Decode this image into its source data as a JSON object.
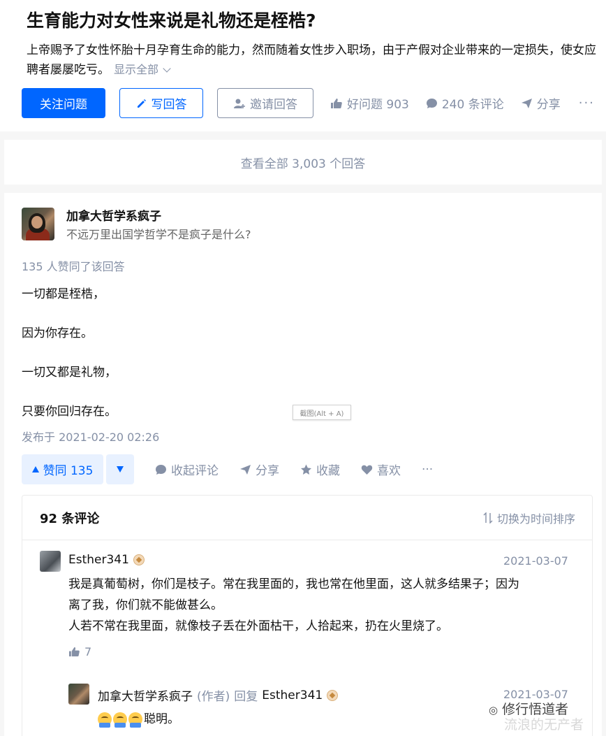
{
  "question": {
    "title": "生育能力对女性来说是礼物还是桎梏?",
    "description": "上帝赐予了女性怀胎十月孕育生命的能力，然而随着女性步入职场，由于产假对企业带来的一定损失，使女应聘者屡屡吃亏。",
    "show_all": "显示全部",
    "follow_label": "关注问题",
    "write_label": "写回答",
    "invite_label": "邀请回答",
    "good_question": "好问题 903",
    "comments": "240 条评论",
    "share": "分享"
  },
  "view_all": "查看全部 3,003 个回答",
  "answer": {
    "author": "加拿大哲学系疯子",
    "bio": "不远万里出国学哲学不是疯子是什么?",
    "voters": "135 人赞同了该回答",
    "paragraphs": [
      "一切都是桎梏，",
      "因为你存在。",
      "一切又都是礼物，",
      "只要你回归存在。"
    ],
    "screenshot_tip": "截图(Alt + A)",
    "published": "发布于 2021-02-20 02:26",
    "vote_up": "赞同 135",
    "collapse_comments": "收起评论",
    "share": "分享",
    "collect": "收藏",
    "like": "喜欢"
  },
  "comments": {
    "count_title": "92 条评论",
    "sort_label": "切换为时间排序",
    "items": [
      {
        "user": "Esther341",
        "date": "2021-03-07",
        "line1": "我是真葡萄树，你们是枝子。常在我里面的，我也常在他里面，这人就多结果子；因为",
        "line2": "离了我，你们就不能做甚么。",
        "line3": "人若不常在我里面，就像枝子丢在外面枯干，人拾起来，扔在火里烧了。",
        "likes": "7"
      },
      {
        "user": "加拿大哲学系疯子",
        "author_tag": "(作者)",
        "reply_word": "回复",
        "reply_to": "Esther341",
        "date": "2021-03-07",
        "text": "聪明。"
      }
    ]
  },
  "watermark": {
    "line1": "修行悟道者",
    "line2": "流浪的无产者"
  },
  "colors": {
    "brand": "#0066ff",
    "muted": "#8590a6"
  }
}
